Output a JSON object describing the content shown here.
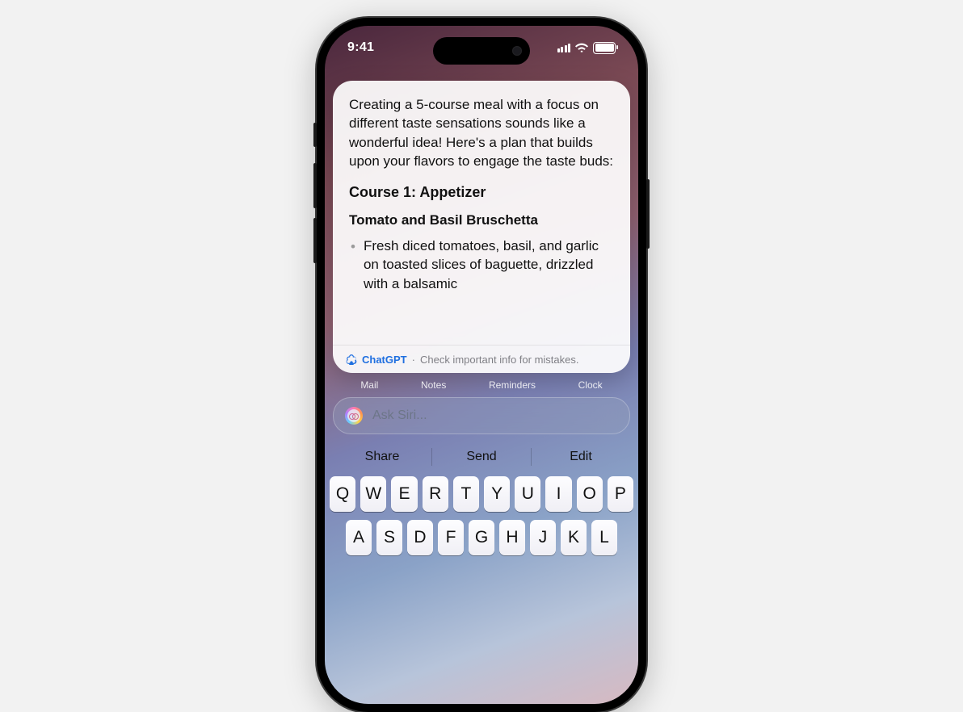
{
  "status": {
    "time": "9:41"
  },
  "card": {
    "intro": "Creating a 5-course meal with a focus on different taste sensations sounds like a wonderful idea! Here's a plan that builds upon your flavors to engage the taste buds:",
    "course_heading": "Course 1: Appetizer",
    "dish_heading": "Tomato and Basil Bruschetta",
    "bullet": "Fresh diced tomatoes, basil, and garlic on toasted slices of baguette, drizzled with a balsamic",
    "source_name": "ChatGPT",
    "source_sep": " · ",
    "disclaimer": "Check important info for mistakes."
  },
  "dock": {
    "mail": "Mail",
    "notes": "Notes",
    "reminders": "Reminders",
    "clock": "Clock"
  },
  "siri": {
    "placeholder": "Ask Siri..."
  },
  "actions": {
    "share": "Share",
    "send": "Send",
    "edit": "Edit"
  },
  "keys": {
    "r1": [
      "Q",
      "W",
      "E",
      "R",
      "T",
      "Y",
      "U",
      "I",
      "O",
      "P"
    ],
    "r2": [
      "A",
      "S",
      "D",
      "F",
      "G",
      "H",
      "J",
      "K",
      "L"
    ]
  }
}
